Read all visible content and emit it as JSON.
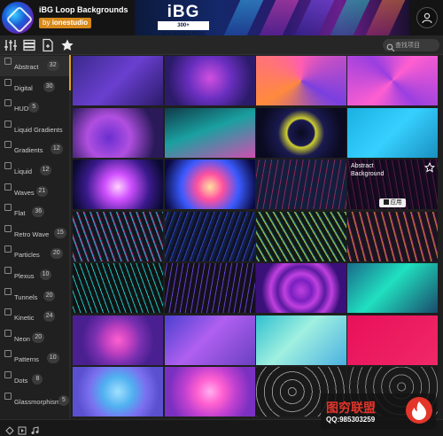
{
  "header": {
    "app_title": "iBG Loop Backgrounds",
    "by_label": "by",
    "by_brand": "ionestudio",
    "banner_title": "iBG",
    "banner_subtitle": "300+ BACKGROUNDS"
  },
  "toolbar": {
    "icons": [
      "sliders-icon",
      "list-icon",
      "new-file-icon",
      "star-icon"
    ],
    "search": {
      "value": "",
      "placeholder": "查找项目"
    }
  },
  "sidebar": {
    "categories": [
      {
        "label": "Abstract",
        "count": "32",
        "active": true
      },
      {
        "label": "Digital",
        "count": "30"
      },
      {
        "label": "HUD",
        "count": "5"
      },
      {
        "label": "Liquid Gradients",
        "count": ""
      },
      {
        "label": "Gradients",
        "count": "12"
      },
      {
        "label": "Liquid",
        "count": "12"
      },
      {
        "label": "Waves",
        "count": "21"
      },
      {
        "label": "Flat",
        "count": "36"
      },
      {
        "label": "Retro Wave",
        "count": "15"
      },
      {
        "label": "Particles",
        "count": "20"
      },
      {
        "label": "Plexus",
        "count": "10"
      },
      {
        "label": "Tunnels",
        "count": "20"
      },
      {
        "label": "Kinetic",
        "count": "24"
      },
      {
        "label": "Neon",
        "count": "20"
      },
      {
        "label": "Patterns",
        "count": "10"
      },
      {
        "label": "Dots",
        "count": "8"
      },
      {
        "label": "Glassmorphism",
        "count": "5"
      }
    ]
  },
  "grid": {
    "hover_tile": {
      "label": "Abstract Background",
      "apply_label": "应用"
    },
    "tiles": [
      {
        "style": "linear-gradient(135deg,#3a2a8c,#6a3fd0 50%,#2b1b6a)"
      },
      {
        "style": "radial-gradient(circle at 50% 45%,#d04fe0 0%,#6a2fc0 40%,#2b1b6a 80%)"
      },
      {
        "style": "conic-gradient(from 0deg,#ff5db1,#7a3fe0,#ff8a3d,#ff5db1)"
      },
      {
        "style": "conic-gradient(from 45deg,#ff5fd0,#9a3fe0,#ff5fd0,#9a3fe0,#ff5fd0)"
      },
      {
        "style": "radial-gradient(circle at 40% 60%,#6a2fd0 0%,#b04fe0 35%,#2a1a5a 75%)"
      },
      {
        "style": "linear-gradient(160deg,#0f3c4a,#1aa0a0 45%,#d04fb0)"
      },
      {
        "style": "radial-gradient(circle at 50% 50%,#0a0a20 0%,#1a1a50 25%,#d0d030 28%,#1a1a50 45%,#0a0a20 80%)"
      },
      {
        "style": "linear-gradient(135deg,#1ab0e0,#36d0ff 50%,#1a90c0)"
      },
      {
        "style": "radial-gradient(circle at 50% 55%,#ffd0ff 0%,#d050ff 25%,#3a1a8c 60%,#0a0a30 90%)"
      },
      {
        "style": "radial-gradient(circle at 50% 55%,#ffe0a0 0%,#ff50a0 25%,#3a5aff 55%,#0a0a40 90%)"
      },
      {
        "style": "repeating-linear-gradient(100deg,#1a1a3a 0 3px,#8a2a5a 3px 4px,#102040 4px 7px)"
      },
      {
        "style": "repeating-linear-gradient(80deg,#2a1030 0 3px,#7a2a6a 3px 4px,#1a1030 4px 7px)"
      },
      {
        "style": "repeating-linear-gradient(70deg,#101820 0 2px,#30a0d0 2px 3px,#a02060 3px 4px,#101820 4px 7px)"
      },
      {
        "style": "repeating-linear-gradient(110deg,#101028 0 3px,#3040c0 3px 4px,#102040 4px 7px)"
      },
      {
        "style": "repeating-linear-gradient(60deg,#121a14 0 2px,#a0c040 2px 3px,#3080a0 3px 4px,#121a14 4px 7px)"
      },
      {
        "style": "repeating-linear-gradient(75deg,#1a1420 0 3px,#c07030 3px 4px,#a03070 4px 5px,#1a1420 5px 8px)"
      },
      {
        "style": "repeating-linear-gradient(70deg,#0e1414 0 2px,#20c0c0 2px 3px,#0e1414 3px 6px)"
      },
      {
        "style": "repeating-linear-gradient(100deg,#14101c 0 2px,#6040d0 2px 3px,#14101c 3px 6px)"
      },
      {
        "style": "radial-gradient(circle at 50% 55%,#c040e0 0%,#7a20c0 20%,#c040e0 32%,#5a1aa0 45%,#c040e0 58%,#3a107a 75%)"
      },
      {
        "style": "linear-gradient(135deg,#1a6a8a,#20e0c0 45%,#1a4a6a)"
      },
      {
        "style": "radial-gradient(circle at 50% 50%,#ff60d0 0%,#c040c0 25%,#7a30b0 45%,#4a2090 70%)"
      },
      {
        "style": "linear-gradient(135deg,#4a40d0,#b060f0 45%,#6a40c0)"
      },
      {
        "style": "linear-gradient(135deg,#30c0d0,#a0f0e0 45%,#4ab0e0)"
      },
      {
        "style": "linear-gradient(135deg,#e8105a,#f02868)"
      },
      {
        "style": "radial-gradient(circle at 50% 50%,#a0e0ff 0%,#50b0f0 30%,#7a70f0 55%,#5a50d0 80%)"
      },
      {
        "style": "radial-gradient(circle at 50% 50%,#ffb0f0 0%,#ff60d0 25%,#c040d0 50%,#7a30c0 80%)"
      },
      {
        "style": "repeating-radial-gradient(circle at 40% 50%,#1a1a1a 0 4px,#909090 4px 5px,#1a1a1a 5px 9px)"
      },
      {
        "style": "repeating-radial-gradient(circle at 60% 40%,#1a1a1a 0 4px,#808080 4px 5px,#1a1a1a 5px 9px)"
      }
    ]
  },
  "bottombar": {
    "icons": [
      "settings-icon",
      "play-icon",
      "music-icon"
    ]
  },
  "watermark": {
    "title": "图穷联盟",
    "qq": "QQ:985303259"
  }
}
